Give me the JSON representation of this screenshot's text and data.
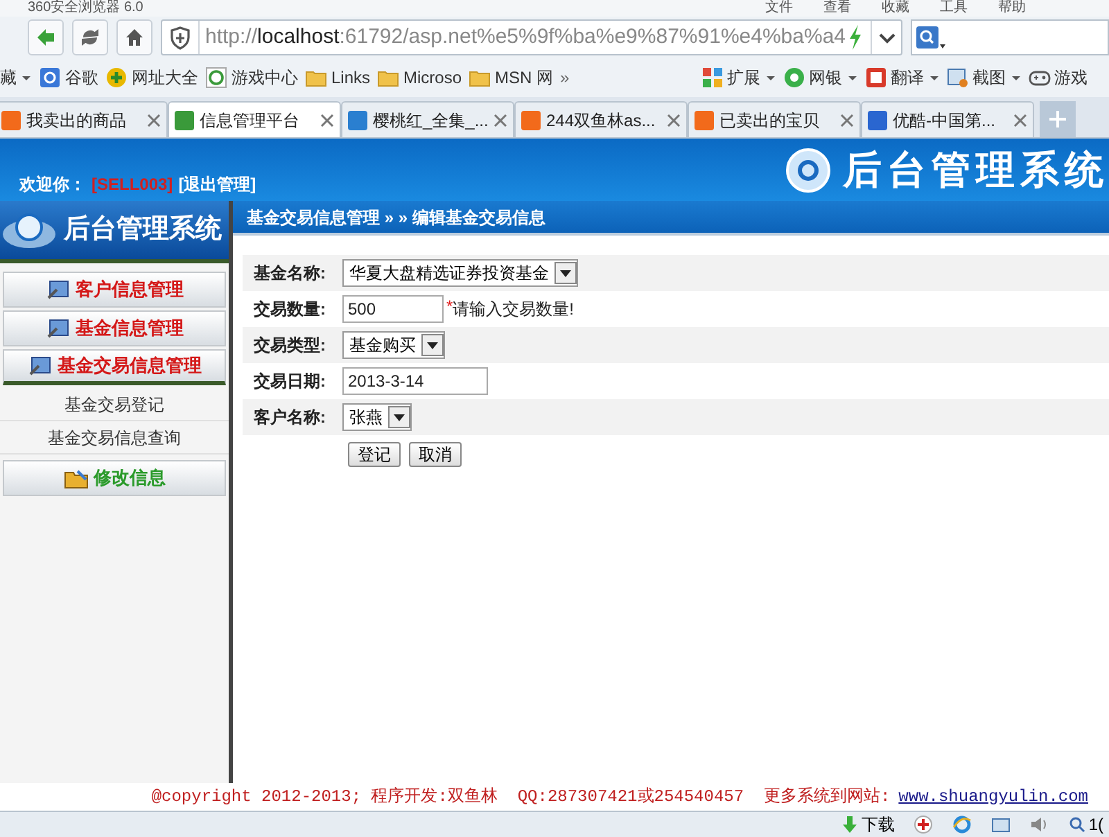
{
  "browser": {
    "title": "360安全浏览器 6.0",
    "menu": [
      "文件",
      "查看",
      "收藏",
      "工具",
      "帮助"
    ],
    "url": {
      "host_prefix": "http://",
      "host": "localhost",
      "rest": ":61792/asp.net%e5%9f%ba%e9%87%91%e4%ba%a4"
    },
    "bookmarks": [
      {
        "label": "藏",
        "kind": "menu"
      },
      {
        "label": "谷歌",
        "kind": "g"
      },
      {
        "label": "网址大全",
        "kind": "plus"
      },
      {
        "label": "游戏中心",
        "kind": "e"
      },
      {
        "label": "Links",
        "kind": "folder"
      },
      {
        "label": "Microso",
        "kind": "folder"
      },
      {
        "label": "MSN 网",
        "kind": "folder"
      },
      {
        "label": "»",
        "kind": "more"
      },
      {
        "label": "扩展",
        "kind": "grid"
      },
      {
        "label": "网银",
        "kind": "shield"
      },
      {
        "label": "翻译",
        "kind": "translate"
      },
      {
        "label": "截图",
        "kind": "scissors"
      },
      {
        "label": "游戏",
        "kind": "gamepad"
      }
    ],
    "tabs": [
      {
        "label": "我卖出的商品",
        "selected": false,
        "color": "#f26a1b"
      },
      {
        "label": "信息管理平台",
        "selected": true,
        "color": "#3a9a3a"
      },
      {
        "label": "樱桃红_全集_...",
        "selected": false,
        "color": "#2a7fd0"
      },
      {
        "label": "244双鱼林as...",
        "selected": false,
        "color": "#f26a1b"
      },
      {
        "label": "已卖出的宝贝",
        "selected": false,
        "color": "#f26a1b"
      },
      {
        "label": "优酷-中国第...",
        "selected": false,
        "color": "#2a66d0"
      }
    ]
  },
  "page": {
    "welcome": "欢迎你：",
    "user": "[SELL003]",
    "logout": "[退出管理]",
    "logo_title": "后台管理系统",
    "sidebar": {
      "title": "后台管理系统",
      "items": [
        {
          "label": "客户信息管理",
          "kind": "section",
          "expanded": false
        },
        {
          "label": "基金信息管理",
          "kind": "section",
          "expanded": false
        },
        {
          "label": "基金交易信息管理",
          "kind": "section",
          "expanded": true,
          "children": [
            {
              "label": "基金交易登记"
            },
            {
              "label": "基金交易信息查询"
            }
          ]
        },
        {
          "label": "修改信息",
          "kind": "settings",
          "expanded": false
        }
      ]
    },
    "breadcrumb": "基金交易信息管理 » » 编辑基金交易信息",
    "form": {
      "fields": [
        {
          "label": "基金名称:",
          "kind": "select",
          "value": "华夏大盘精选证券投资基金"
        },
        {
          "label": "交易数量:",
          "kind": "input",
          "value": "500",
          "required_mark": "*",
          "note": "请输入交易数量!"
        },
        {
          "label": "交易类型:",
          "kind": "select",
          "value": "基金购买"
        },
        {
          "label": "交易日期:",
          "kind": "input",
          "value": "2013-3-14"
        },
        {
          "label": "客户名称:",
          "kind": "select",
          "value": "张燕"
        }
      ],
      "buttons": [
        "登记",
        "取消"
      ]
    },
    "footer": {
      "text": "@copyright 2012-2013; 程序开发:双鱼林  QQ:287307421或254540457  更多系统到网站:",
      "link": "www.shuangyulin.com"
    }
  },
  "status_bar": {
    "download": "下载",
    "zoom": "1("
  }
}
